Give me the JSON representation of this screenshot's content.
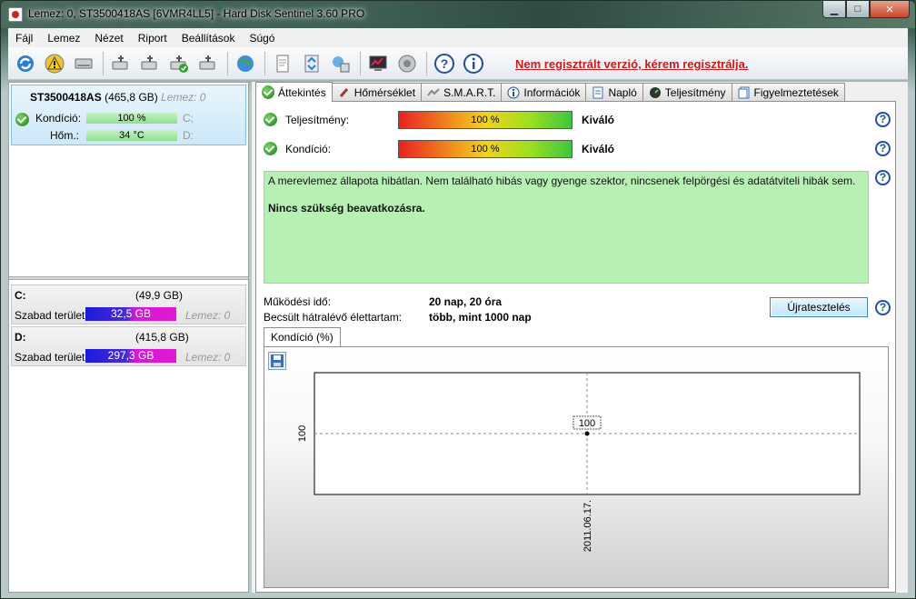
{
  "window": {
    "title": "Lemez: 0, ST3500418AS [6VMR4LL5]  -  Hard Disk Sentinel 3.60 PRO"
  },
  "menu": [
    "Fájl",
    "Lemez",
    "Nézet",
    "Riport",
    "Beállítások",
    "Súgó"
  ],
  "toolbar": {
    "icons": [
      "refresh-icon",
      "warning-icon",
      "disk-icon",
      "usb-disk-icon",
      "usb-disk-icon",
      "usb-disk-check-icon",
      "usb-disk-tool-icon",
      "globe-icon",
      "report-icon",
      "transfer-icon",
      "network-icon",
      "chart-icon",
      "speaker-icon",
      "help-icon",
      "info-icon"
    ],
    "register_link": "Nem regisztrált verzió, kérem regisztrálja."
  },
  "left": {
    "disk": {
      "name": "ST3500418AS",
      "size": "(465,8 GB)",
      "num": "Lemez: 0",
      "condition_label": "Kondíció:",
      "condition_value": "100 %",
      "condition_fill": 1.0,
      "temp_label": "Hőm.:",
      "temp_value": "34 °C",
      "drive1": "C;",
      "drive2": "D:"
    },
    "partitions": [
      {
        "letter": "C:",
        "size": "(49,9 GB)",
        "free_label": "Szabad terület",
        "free": "32,5 GB",
        "disk": "Lemez: 0"
      },
      {
        "letter": "D:",
        "size": "(415,8 GB)",
        "free_label": "Szabad terület",
        "free": "297,3 GB",
        "disk": "Lemez: 0"
      }
    ]
  },
  "tabs": [
    "Áttekintés",
    "Hőmérséklet",
    "S.M.A.R.T.",
    "Információk",
    "Napló",
    "Teljesítmény",
    "Figyelmeztetések"
  ],
  "overview": {
    "performance_label": "Teljesítmény:",
    "performance_value": "100 %",
    "performance_verdict": "Kiváló",
    "condition_label": "Kondíció:",
    "condition_value": "100 %",
    "condition_verdict": "Kiváló",
    "info_text": "A merevlemez állapota hibátlan. Nem található hibás vagy gyenge szektor, nincsenek felpörgési és adatátviteli hibák sem.",
    "info_bold": "Nincs szükség beavatkozásra.",
    "uptime_label": "Működési idő:",
    "uptime_value": "20 nap, 20 óra",
    "life_label": "Becsült hátralévő élettartam:",
    "life_value": "több, mint 1000 nap",
    "retest_button": "Újratesztelés",
    "chart_tab": "Kondíció  (%)"
  },
  "chart_data": {
    "type": "line",
    "title": "",
    "x": [
      "2011.06.17."
    ],
    "series": [
      {
        "values": [
          100
        ]
      }
    ],
    "data_labels": [
      "100"
    ],
    "y_ticks": [
      "100"
    ],
    "grid": true
  },
  "colors": {
    "register_link": "#d01919",
    "info_box": "#b7f0b3",
    "free_space_bar_start": "#1a1adb",
    "free_space_bar_end": "#e01ad0"
  }
}
